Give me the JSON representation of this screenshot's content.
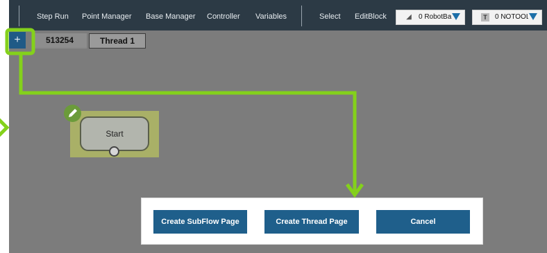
{
  "menubar": {
    "items": [
      "Step Run",
      "Point Manager",
      "Base Manager",
      "Controller",
      "Variables",
      "Select",
      "EditBlock"
    ],
    "base_dropdown": {
      "icon": "robot-base-icon",
      "value": "0 RobotBa"
    },
    "tool_dropdown": {
      "icon_glyph": "T",
      "value": "0 NOTOOL"
    }
  },
  "flow": {
    "add_label": "+",
    "tabs": [
      {
        "label": "513254"
      },
      {
        "label": "Thread 1"
      }
    ],
    "start_node": {
      "label": "Start"
    }
  },
  "dialog": {
    "buttons": [
      "Create SubFlow Page",
      "Create Thread Page",
      "Cancel"
    ]
  },
  "colors": {
    "accent_green": "#84d11b",
    "primary_blue": "#1f5f8b",
    "menubar": "#2c3a45",
    "canvas": "#7c7c7c"
  }
}
